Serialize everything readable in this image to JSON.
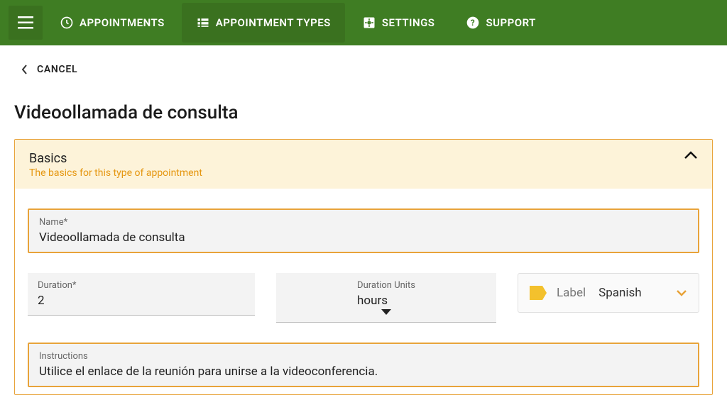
{
  "nav": {
    "appointments": "APPOINTMENTS",
    "apptTypes": "APPOINTMENT TYPES",
    "settings": "SETTINGS",
    "support": "SUPPORT"
  },
  "cancel": "CANCEL",
  "pageTitle": "Videoollamada de consulta",
  "panel": {
    "title": "Basics",
    "subtitle": "The basics for this type of appointment"
  },
  "fields": {
    "nameLabel": "Name*",
    "nameValue": "Videoollamada de consulta",
    "durationLabel": "Duration*",
    "durationValue": "2",
    "unitsLabel": "Duration Units",
    "unitsValue": "hours",
    "labelWord": "Label",
    "labelValue": "Spanish",
    "instructionsLabel": "Instructions",
    "instructionsValue": "Utilice el enlace de la reunión para unirse a la videoconferencia."
  }
}
